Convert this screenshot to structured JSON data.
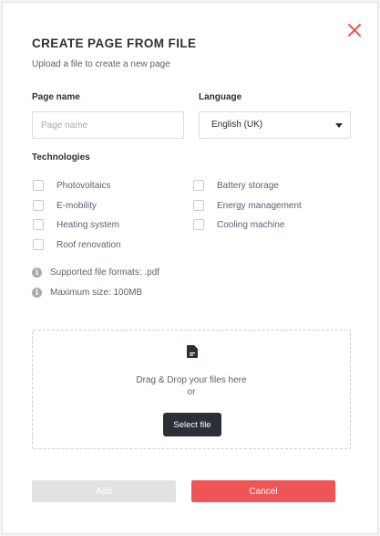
{
  "dialog": {
    "title": "CREATE PAGE FROM FILE",
    "subtitle": "Upload a file to create a new page",
    "close_icon": "close-icon"
  },
  "form": {
    "page_name_label": "Page name",
    "page_name_placeholder": "Page name",
    "page_name_value": "",
    "language_label": "Language",
    "language_value": "English (UK)",
    "technologies_label": "Technologies",
    "technologies": [
      {
        "label": "Photovoltaics",
        "checked": false
      },
      {
        "label": "Battery storage",
        "checked": false
      },
      {
        "label": "E-mobility",
        "checked": false
      },
      {
        "label": "Energy management",
        "checked": false
      },
      {
        "label": "Heating system",
        "checked": false
      },
      {
        "label": "Cooling machine",
        "checked": false
      },
      {
        "label": "Roof renovation",
        "checked": false
      }
    ]
  },
  "info": {
    "formats": "Supported file formats: .pdf",
    "max_size": "Maximum size: 100MB",
    "icon": "info-icon"
  },
  "dropzone": {
    "icon": "file-icon",
    "text": "Drag & Drop your files here",
    "or": "or",
    "button": "Select file"
  },
  "footer": {
    "add": "Add",
    "cancel": "Cancel"
  },
  "colors": {
    "accent_red": "#f05555",
    "dark_button": "#2b2f36",
    "disabled_button": "#e1e2e4"
  }
}
